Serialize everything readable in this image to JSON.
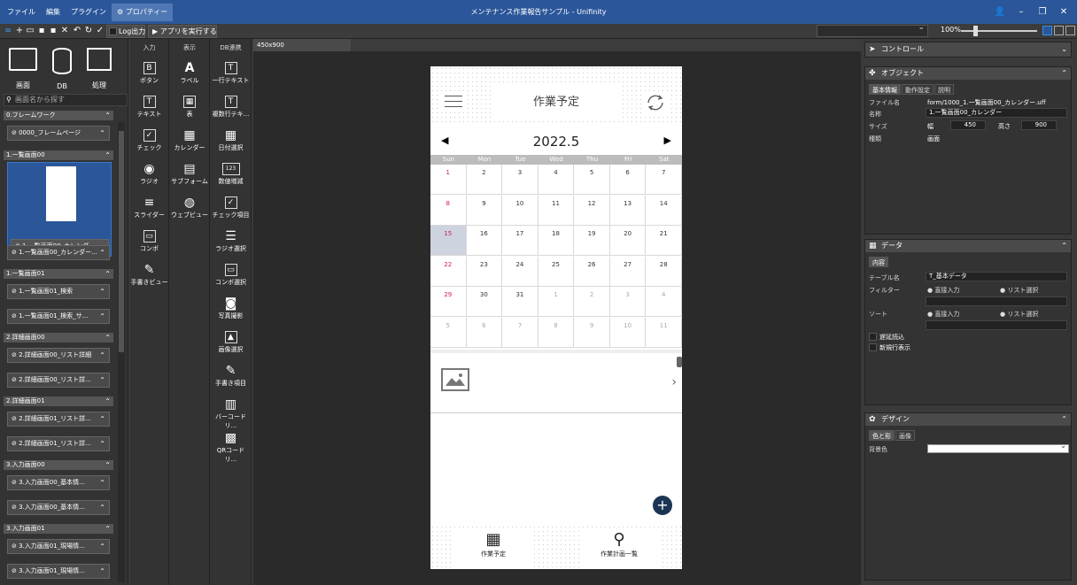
{
  "menubar": {
    "items": [
      "ファイル",
      "編集",
      "プラグイン",
      "⚙ プロパティー"
    ],
    "title": "メンテナンス作業報告サンプル - Unifinity"
  },
  "toolbar": {
    "log_label": "Log出力",
    "run_label": "▶ アプリを実行する",
    "zoom": "100%"
  },
  "leftpanel": {
    "tabs": [
      "画面",
      "DB",
      "処理"
    ],
    "search_placeholder": "画面名から探す",
    "groups": [
      {
        "header": "0.フレームワーク",
        "items": [
          "0000_フレームページ"
        ]
      },
      {
        "header": "1.一覧画面00",
        "items": [
          "1.一覧画面00_カレンダー",
          "1.一覧画面00_カレンダー..."
        ]
      },
      {
        "header": "1.一覧画面01",
        "items": [
          "1.一覧画面01_検索",
          "1.一覧画面01_検索_サ..."
        ]
      },
      {
        "header": "2.詳細画面00",
        "items": [
          "2.詳細画面00_リスト詳細",
          "2.詳細画面00_リスト詳..."
        ]
      },
      {
        "header": "2.詳細画面01",
        "items": [
          "2.詳細画面01_リスト詳...",
          "2.詳細画面01_リスト詳..."
        ]
      },
      {
        "header": "3.入力画面00",
        "items": [
          "3.入力画面00_基本情...",
          "3.入力画面00_基本情..."
        ]
      },
      {
        "header": "3.入力画面01",
        "items": [
          "3.入力画面01_現場情...",
          "3.入力画面01_現場情..."
        ]
      }
    ]
  },
  "palette": {
    "input": {
      "header": "入力",
      "items": [
        "ボタン",
        "テキスト",
        "チェック",
        "ラジオ",
        "スライダー",
        "コンボ",
        "手書きビュー"
      ]
    },
    "display": {
      "header": "表示",
      "items": [
        "ラベル",
        "表",
        "カレンダー",
        "サブフォーム",
        "ウェブビュー"
      ]
    },
    "db": {
      "header": "DB連携",
      "items": [
        "一行テキスト",
        "複数行テキ...",
        "日付選択",
        "数値増減",
        "チェック項目",
        "ラジオ選択",
        "コンボ選択",
        "写真撮影",
        "画像選択",
        "手書き項目",
        "バーコードリ...",
        "QRコードリ..."
      ]
    }
  },
  "canvas": {
    "tab_label": "450x900"
  },
  "phone": {
    "title": "作業予定",
    "year_month": "2022.5",
    "prev": "◀",
    "next": "▶",
    "weekdays": [
      "Sun",
      "Mon",
      "Tue",
      "Wed",
      "Thu",
      "Fri",
      "Sat"
    ],
    "days": [
      [
        "1",
        "2",
        "3",
        "4",
        "5",
        "6",
        "7"
      ],
      [
        "8",
        "9",
        "10",
        "11",
        "12",
        "13",
        "14"
      ],
      [
        "15",
        "16",
        "17",
        "18",
        "19",
        "20",
        "21"
      ],
      [
        "22",
        "23",
        "24",
        "25",
        "26",
        "27",
        "28"
      ],
      [
        "29",
        "30",
        "31",
        "1",
        "2",
        "3",
        "4"
      ],
      [
        "5",
        "6",
        "7",
        "8",
        "9",
        "10",
        "11"
      ]
    ],
    "fab": "+",
    "footer": [
      "作業予定",
      "作業計画一覧"
    ]
  },
  "rightpanel": {
    "control_label": "コントロール",
    "object": {
      "header": "オブジェクト",
      "tabs": [
        "基本情報",
        "動作設定",
        "説明"
      ],
      "file_label": "ファイル名",
      "file_value": "form/1000_1.一覧画面00_カレンダー.uff",
      "name_label": "名称",
      "name_value": "1.一覧画面00_カレンダー",
      "size_label": "サイズ",
      "width_label": "幅",
      "width_value": "450",
      "height_label": "高さ",
      "height_value": "900",
      "type_label": "種類",
      "type_value": "画面"
    },
    "data": {
      "header": "データ",
      "tab": "内容",
      "table_label": "テーブル名",
      "table_value": "T_基本データ",
      "filter_label": "フィルター",
      "sort_label": "ソート",
      "direct": "直接入力",
      "list": "リスト選択",
      "lazy": "遅延読込",
      "newrow": "新規行表示"
    },
    "design": {
      "header": "デザイン",
      "tabs": [
        "色と形",
        "画像"
      ],
      "bg_label": "背景色"
    }
  },
  "colors": {
    "titlebar": "#2b579a",
    "red_day": "#d21a4a",
    "selected_day": "#cdd3df",
    "fab": "#1c3453"
  }
}
